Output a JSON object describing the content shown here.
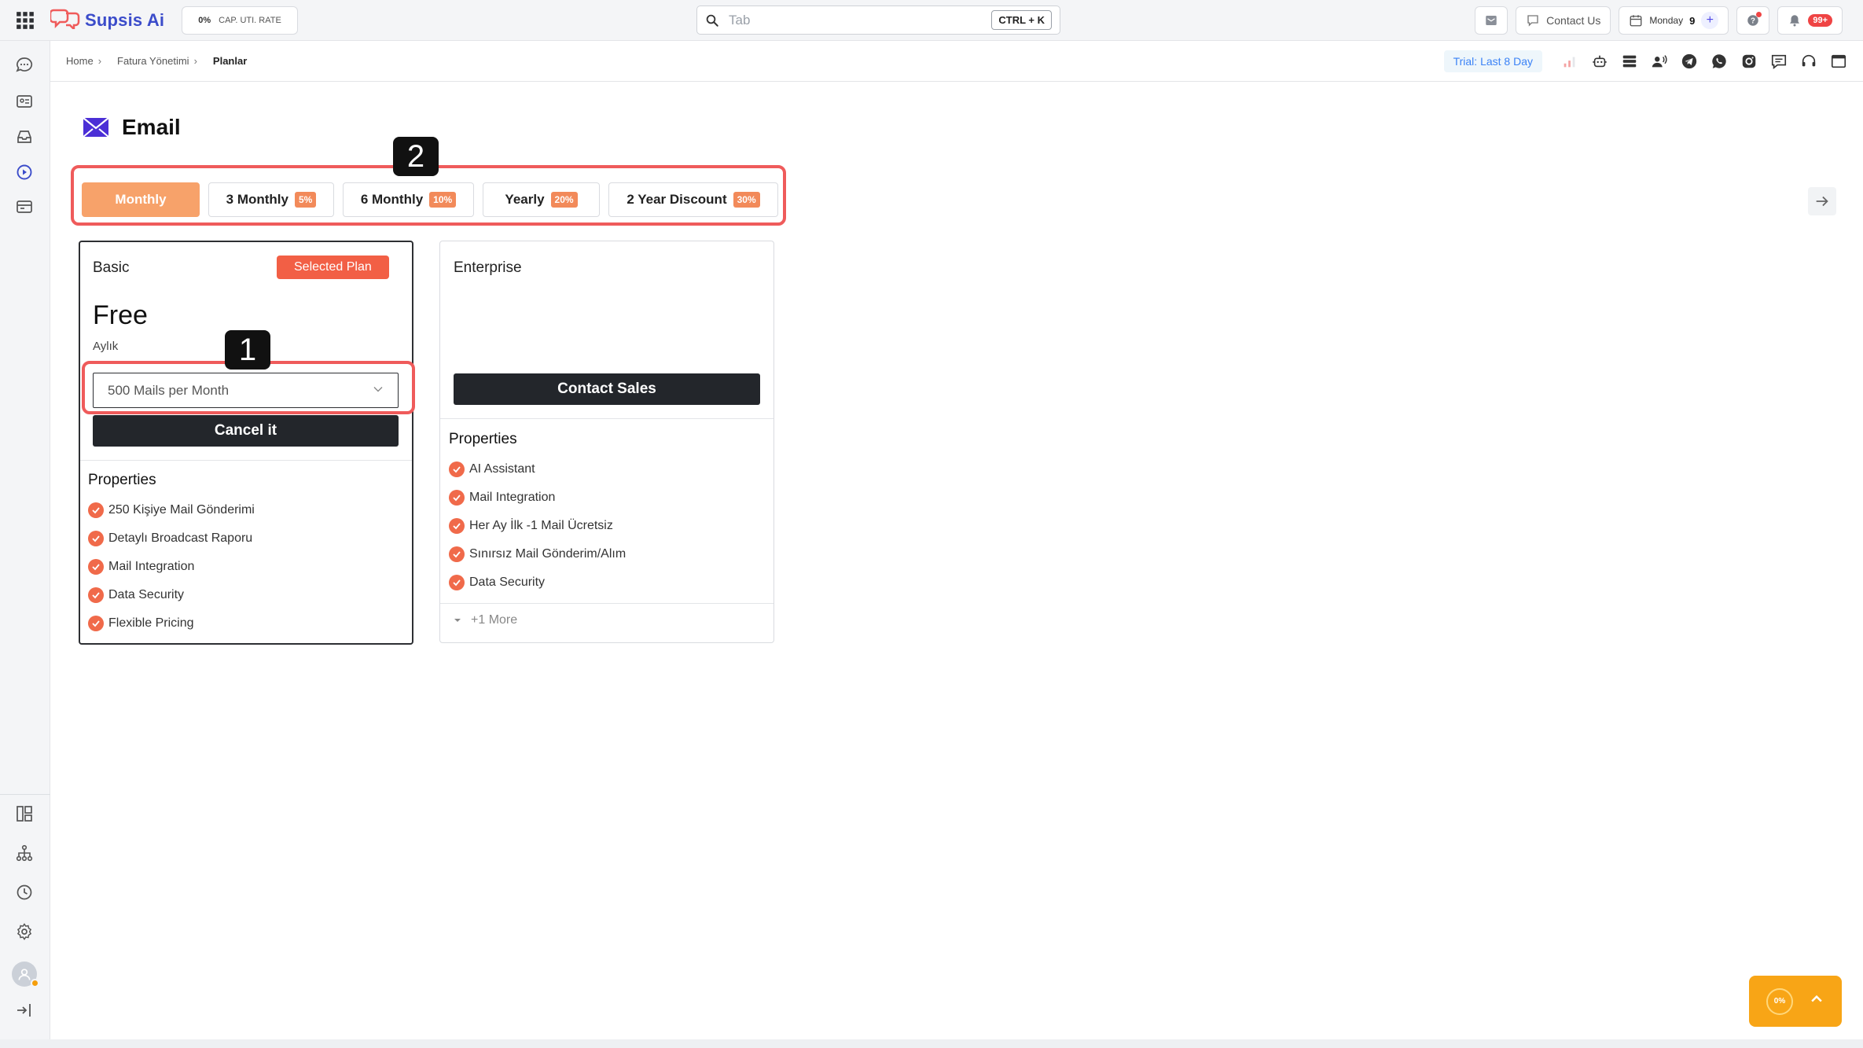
{
  "app": {
    "name": "Supsis Ai",
    "brand_color": "#3b4cca",
    "accent_color": "#f25f45"
  },
  "topbar": {
    "cap_value": "0%",
    "cap_label": "CAP. UTI. RATE",
    "search_placeholder": "Tab",
    "search_shortcut": "CTRL + K",
    "contact_label": "Contact Us",
    "calendar_day": "Monday",
    "calendar_date": "9",
    "notif_badge": "99+"
  },
  "breadcrumb": {
    "home": "Home",
    "level2": "Fatura Yönetimi",
    "current": "Planlar"
  },
  "subheader": {
    "trial": "Trial: Last 8 Day"
  },
  "page": {
    "title": "Email"
  },
  "tabs": [
    {
      "label": "Monthly",
      "discount": ""
    },
    {
      "label": "3 Monthly",
      "discount": "5%"
    },
    {
      "label": "6 Monthly",
      "discount": "10%"
    },
    {
      "label": "Yearly",
      "discount": "20%"
    },
    {
      "label": "2 Year Discount",
      "discount": "30%"
    }
  ],
  "markers": {
    "one": "1",
    "two": "2"
  },
  "plans": {
    "basic": {
      "name": "Basic",
      "badge": "Selected Plan",
      "price": "Free",
      "period": "Aylık",
      "selected_option": "500 Mails per Month",
      "button": "Cancel it",
      "properties_title": "Properties",
      "properties": [
        "250 Kişiye Mail Gönderimi",
        "Detaylı Broadcast Raporu",
        "Mail Integration",
        "Data Security",
        "Flexible Pricing"
      ]
    },
    "enterprise": {
      "name": "Enterprise",
      "button": "Contact Sales",
      "properties_title": "Properties",
      "properties": [
        "AI Assistant",
        "Mail Integration",
        "Her Ay İlk -1 Mail Ücretsiz",
        "Sınırsız Mail Gönderim/Alım",
        "Data Security"
      ],
      "more": "+1 More"
    }
  },
  "fab": {
    "value": "0%"
  }
}
